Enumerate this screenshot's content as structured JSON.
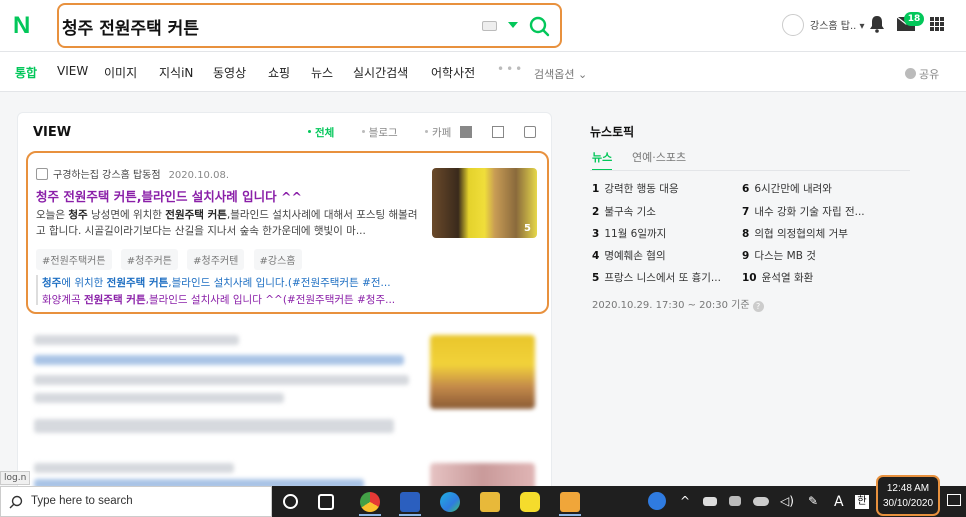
{
  "header": {
    "logo": "N",
    "search_value": "청주 전원주택 커튼",
    "user_name": "강스홈 탑.. ▾",
    "mail_badge": "18"
  },
  "nav": {
    "tabs": [
      "통합",
      "VIEW",
      "이미지",
      "지식iN",
      "동영상",
      "쇼핑",
      "뉴스",
      "실시간검색",
      "어학사전"
    ],
    "more": "•••",
    "options": "검색옵션",
    "share": "공유"
  },
  "view": {
    "title": "VIEW",
    "filters": [
      "전체",
      "블로그",
      "카페"
    ],
    "result": {
      "source": "구경하는집 강스홈 탑동점",
      "date": "2020.10.08.",
      "title": "청주 전원주택 커튼,블라인드 설치사례 입니다 ^^",
      "desc_1": "오늘은 ",
      "desc_bold_1": "청주",
      "desc_2": " 낭성면에 위치한 ",
      "desc_bold_2": "전원주택 커튼",
      "desc_3": ",블라인드 설치사례에 대해서 포스팅 해볼려고 합니다. 시골길이라기보다는 산길을 지나서 숲속 한가운데에 햇빛이 마...",
      "tags": [
        "#전원주택커튼",
        "#청주커튼",
        "#청주커텐",
        "#강스홈"
      ],
      "sub_1_pre": "청주",
      "sub_1_mid": "에 위치한 ",
      "sub_1_bold": "전원주택 커튼",
      "sub_1_post": ",블라인드 설치사례 입니다.(#전원주택커튼 #전...",
      "sub_2_pre": "화양계곡 ",
      "sub_2_bold": "전원주택 커튼",
      "sub_2_post": ",블라인드 설치사례 입니다 ^^(#전원주택커튼 #청주...",
      "thumb_count": "5"
    }
  },
  "news": {
    "title": "뉴스토픽",
    "tabs": [
      "뉴스",
      "연예·스포츠"
    ],
    "items": [
      {
        "rank": "1",
        "text": "강력한 행동 대응"
      },
      {
        "rank": "2",
        "text": "불구속 기소"
      },
      {
        "rank": "3",
        "text": "11월 6일까지"
      },
      {
        "rank": "4",
        "text": "명예훼손 혐의"
      },
      {
        "rank": "5",
        "text": "프랑스 니스에서 또 흉기..."
      },
      {
        "rank": "6",
        "text": "6시간만에 내려와"
      },
      {
        "rank": "7",
        "text": "내수 강화 기술 자립 전..."
      },
      {
        "rank": "8",
        "text": "의협 의정협의체 거부"
      },
      {
        "rank": "9",
        "text": "다스는 MB 것"
      },
      {
        "rank": "10",
        "text": "윤석열 화환"
      }
    ],
    "time": "2020.10.29. 17:30 ~ 20:30 기준"
  },
  "status_url": "log.n",
  "taskbar": {
    "search_placeholder": "Type here to search",
    "ime_a": "A",
    "ime_han": "한",
    "time": "12:48 AM",
    "date": "30/10/2020"
  },
  "colors": {
    "accent": "#03c75a",
    "highlight": "#e8913e",
    "visited_title": "#8a1fa8",
    "link": "#1d6ec2"
  }
}
